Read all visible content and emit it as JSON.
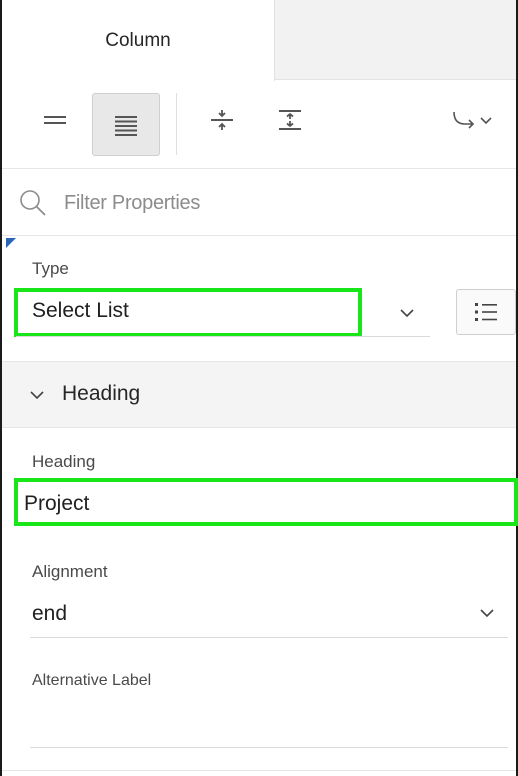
{
  "tabs": [
    {
      "label": "Column",
      "active": true
    }
  ],
  "toolbar": {
    "buttons": [
      {
        "icon": "collapse-rows-icon"
      },
      {
        "icon": "expand-rows-icon",
        "active": true
      },
      {
        "icon": "show-common-icon"
      },
      {
        "icon": "show-all-icon"
      },
      {
        "icon": "go-to-group-icon"
      }
    ]
  },
  "filter": {
    "placeholder": "Filter Properties",
    "value": ""
  },
  "properties": {
    "type": {
      "label": "Type",
      "value": "Select List"
    },
    "group": {
      "title": "Heading",
      "expanded": true
    },
    "heading": {
      "label": "Heading",
      "value": "Project"
    },
    "alignment": {
      "label": "Alignment",
      "value": "end"
    },
    "alternative_label": {
      "label": "Alternative Label",
      "value": ""
    }
  },
  "colors": {
    "highlight": "#19e619",
    "accent": "#2b63b5"
  }
}
